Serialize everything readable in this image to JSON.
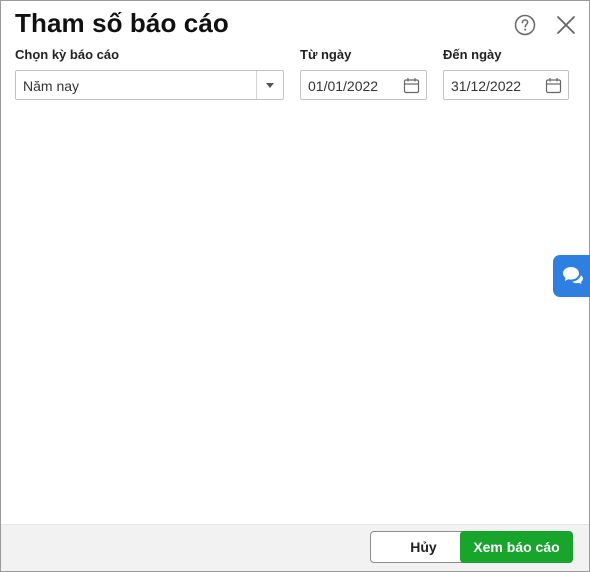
{
  "dialog": {
    "title": "Tham số báo cáo"
  },
  "fields": {
    "period_label": "Chọn kỳ báo cáo",
    "period_value": "Năm nay",
    "from_label": "Từ ngày",
    "from_value": "01/01/2022",
    "to_label": "Đến ngày",
    "to_value": "31/12/2022"
  },
  "footer": {
    "cancel_label": "Hủy",
    "view_label": "Xem báo cáo"
  },
  "icons": {
    "help": "help-circle-icon",
    "close": "close-icon",
    "calendar": "calendar-icon",
    "dropdown": "chevron-down-icon",
    "chat": "chat-icon"
  },
  "colors": {
    "primary": "#17a52b",
    "chat": "#2d7fe0",
    "footer_bg": "#f2f2f2"
  }
}
